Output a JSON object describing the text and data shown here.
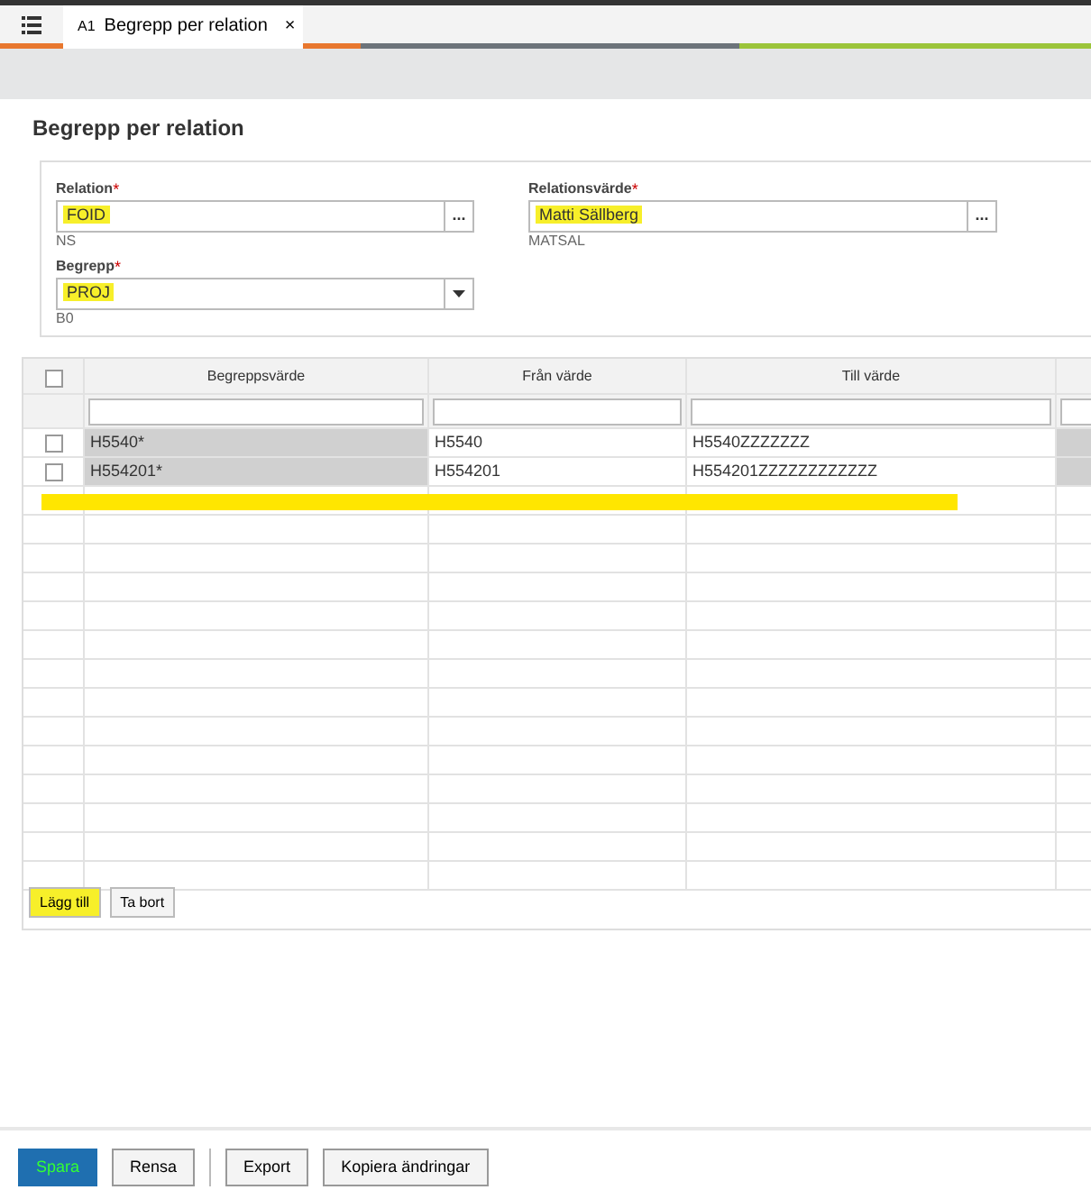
{
  "tabs": [
    {
      "badge": "A1",
      "label": "Begrepp per relation",
      "close": "×",
      "selected": true
    }
  ],
  "page_title": "Begrepp per relation",
  "fields": [
    {
      "kind": "lookup",
      "label": "Relation",
      "required": "*",
      "value": "FOID",
      "hint": "NS",
      "highlighted": true,
      "button": "..."
    },
    {
      "kind": "lookup",
      "label": "Relationsvärde",
      "required": "*",
      "value": "Matti Sällberg",
      "hint": "MATSAL",
      "highlighted": true,
      "button": "..."
    },
    {
      "kind": "select",
      "label": "Begrepp",
      "required": "*",
      "value": "PROJ",
      "hint": "B0",
      "highlighted": true
    }
  ],
  "table": {
    "columns": [
      "Begreppsvärde",
      "Från värde",
      "Till värde"
    ],
    "select_all_checked": false,
    "rows": [
      {
        "checked": false,
        "cells": [
          "H5540*",
          "H5540",
          "H5540ZZZZZZZ"
        ]
      },
      {
        "checked": false,
        "cells": [
          "H554201*",
          "H554201",
          "H554201ZZZZZZZZZZZZ"
        ]
      }
    ],
    "annotation_stroke": true
  },
  "table_buttons": [
    {
      "label": "Lägg till",
      "highlighted": true
    },
    {
      "label": "Ta bort",
      "highlighted": false
    }
  ],
  "footer_buttons": [
    {
      "label": "Spara",
      "kind": "primary"
    },
    {
      "label": "Rensa",
      "kind": "plain"
    },
    {
      "label": "Export",
      "kind": "plain"
    },
    {
      "label": "Kopiera ändringar",
      "kind": "plain"
    }
  ]
}
